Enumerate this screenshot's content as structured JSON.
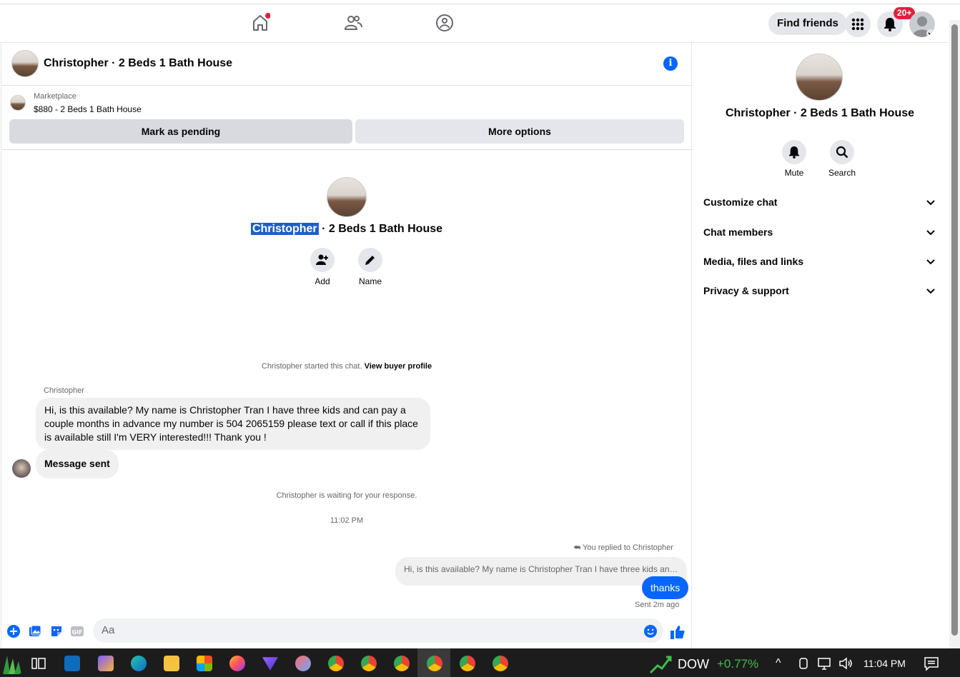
{
  "topnav": {
    "find_friends": "Find friends",
    "notif_badge": "20+"
  },
  "chat": {
    "title": "Christopher · 2 Beds 1 Bath House",
    "info_glyph": "i",
    "marketplace_label": "Marketplace",
    "listing": "$880 - 2 Beds 1 Bath House",
    "mark_pending": "Mark as pending",
    "more_options": "More options",
    "center_name_highlight": "Christopher",
    "center_name_rest": "· 2 Beds 1 Bath House",
    "add_label": "Add",
    "name_label": "Name",
    "started_text": "Christopher started this chat.",
    "view_profile": "View buyer profile",
    "sender": "Christopher",
    "message1": "Hi, is this available? My name is Christopher Tran I have three kids and can pay a couple months in advance my number is 504 2065159 please text or call if this place is available still I'm VERY interested!!! Thank you !",
    "message2": "Message sent",
    "waiting_text": "Christopher is waiting for your response.",
    "timestamp": "11:02 PM",
    "replied_label": "You replied to Christopher",
    "reply_preview": "Hi, is this available? My name is Christopher Tran I have three kids and...",
    "my_message": "thanks",
    "sent_ago": "Sent 2m ago",
    "input_placeholder": "Aa"
  },
  "sidebar": {
    "name": "Christopher · 2 Beds 1 Bath House",
    "mute": "Mute",
    "search": "Search",
    "sections": [
      "Customize chat",
      "Chat members",
      "Media, files and links",
      "Privacy & support"
    ]
  },
  "taskbar": {
    "ticker": "DOW",
    "ticker_change": "+0.77%",
    "clock": "11:04 PM"
  },
  "colors": {
    "accent": "#0866ff",
    "notif": "#e41e3f",
    "ticker_green": "#3fbf4f"
  },
  "icons": [
    "home-icon",
    "friends-icon",
    "groups-icon",
    "menu-grid-icon",
    "bell-icon",
    "info-icon",
    "add-person-icon",
    "pencil-icon",
    "plus-icon",
    "image-icon",
    "sticker-icon",
    "gif-icon",
    "emoji-icon",
    "like-icon",
    "chevron-down-icon"
  ]
}
